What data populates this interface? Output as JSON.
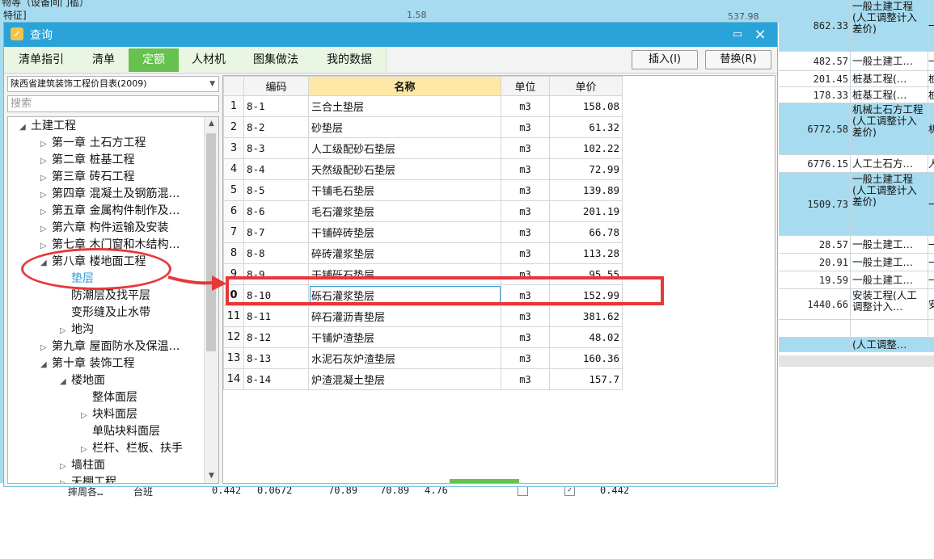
{
  "background": {
    "top_text_1": "物等（设备间门槛）",
    "top_text_2": "特征]",
    "top_num_1": "1.58",
    "top_num_2": "537.98",
    "right_rows": [
      {
        "amount": "862.33",
        "category": "一般土建工程(人工调整计入差价)",
        "extra": "一",
        "h": 64,
        "hl": true
      },
      {
        "amount": "482.57",
        "category": "一般土建工…",
        "extra": "一",
        "h": 24,
        "hl": false
      },
      {
        "amount": "201.45",
        "category": "桩基工程(…",
        "extra": "桩",
        "h": 20,
        "hl": false
      },
      {
        "amount": "178.33",
        "category": "桩基工程(…",
        "extra": "桩",
        "h": 20,
        "hl": false
      },
      {
        "amount": "6772.58",
        "category": "机械土石方工程(人工调整计入差价)",
        "extra": "机",
        "h": 64,
        "hl": true
      },
      {
        "amount": "6776.15",
        "category": "人工土石方…",
        "extra": "人",
        "h": 22,
        "hl": false
      },
      {
        "amount": "1509.73",
        "category": "一般土建工程(人工调整计入差价)",
        "extra": "一",
        "h": 78,
        "hl": true
      },
      {
        "amount": "28.57",
        "category": "一般土建工…",
        "extra": "一",
        "h": 22,
        "hl": false
      },
      {
        "amount": "20.91",
        "category": "一般土建工…",
        "extra": "一",
        "h": 22,
        "hl": false
      },
      {
        "amount": "19.59",
        "category": "一般土建工…",
        "extra": "一",
        "h": 22,
        "hl": false
      },
      {
        "amount": "1440.66",
        "category": "安装工程(人工调整计入…",
        "extra": "安",
        "h": 38,
        "hl": false
      },
      {
        "amount": "",
        "category": "",
        "extra": "",
        "h": 22,
        "hl": false
      },
      {
        "amount": "",
        "category": "(人工调整…",
        "extra": "",
        "h": 18,
        "hl": true
      }
    ],
    "bottom_row": [
      "摔周各…",
      "台班",
      "0.442",
      "0.0672",
      "70.89",
      "70.89",
      "4.76",
      "0.442"
    ]
  },
  "dialog": {
    "title": "查询",
    "close_icon": "×",
    "maximize_icon": "▭",
    "tabs": [
      "清单指引",
      "清单",
      "定额",
      "人材机",
      "图集做法",
      "我的数据"
    ],
    "active_tab": "定额",
    "insert_label": "插入(I)",
    "replace_label": "替换(R)"
  },
  "left_panel": {
    "database": "陕西省建筑装饰工程价目表(2009)",
    "search_placeholder": "搜索",
    "tree": [
      {
        "label": "土建工程",
        "level": 0,
        "state": "expanded"
      },
      {
        "label": "第一章  土石方工程",
        "level": 1,
        "state": "collapsed"
      },
      {
        "label": "第二章  桩基工程",
        "level": 1,
        "state": "collapsed"
      },
      {
        "label": "第三章  砖石工程",
        "level": 1,
        "state": "collapsed"
      },
      {
        "label": "第四章  混凝土及钢筋混…",
        "level": 1,
        "state": "collapsed"
      },
      {
        "label": "第五章  金属构件制作及…",
        "level": 1,
        "state": "collapsed"
      },
      {
        "label": "第六章  构件运输及安装",
        "level": 1,
        "state": "collapsed"
      },
      {
        "label": "第七章  木门窗和木结构…",
        "level": 1,
        "state": "collapsed"
      },
      {
        "label": "第八章  楼地面工程",
        "level": 1,
        "state": "expanded"
      },
      {
        "label": "垫层",
        "level": 2,
        "state": "leaf",
        "selected": true
      },
      {
        "label": "防潮层及找平层",
        "level": 2,
        "state": "leaf"
      },
      {
        "label": "变形缝及止水带",
        "level": 2,
        "state": "leaf"
      },
      {
        "label": "地沟",
        "level": 2,
        "state": "collapsed"
      },
      {
        "label": "第九章  屋面防水及保温…",
        "level": 1,
        "state": "collapsed"
      },
      {
        "label": "第十章  装饰工程",
        "level": 1,
        "state": "expanded"
      },
      {
        "label": "楼地面",
        "level": 2,
        "state": "expanded"
      },
      {
        "label": "整体面层",
        "level": 3,
        "state": "leaf"
      },
      {
        "label": "块料面层",
        "level": 3,
        "state": "collapsed"
      },
      {
        "label": "单贴块料面层",
        "level": 3,
        "state": "leaf"
      },
      {
        "label": "栏杆、栏板、扶手",
        "level": 3,
        "state": "collapsed"
      },
      {
        "label": "墙柱面",
        "level": 2,
        "state": "collapsed"
      },
      {
        "label": "天棚工程",
        "level": 2,
        "state": "collapsed"
      }
    ]
  },
  "grid": {
    "columns": [
      "编码",
      "名称",
      "单位",
      "单价"
    ],
    "rows": [
      {
        "idx": "1",
        "code": "8-1",
        "name": "三合土垫层",
        "unit": "m3",
        "price": "158.08"
      },
      {
        "idx": "2",
        "code": "8-2",
        "name": "砂垫层",
        "unit": "m3",
        "price": "61.32"
      },
      {
        "idx": "3",
        "code": "8-3",
        "name": "人工级配砂石垫层",
        "unit": "m3",
        "price": "102.22"
      },
      {
        "idx": "4",
        "code": "8-4",
        "name": "天然级配砂石垫层",
        "unit": "m3",
        "price": "72.99"
      },
      {
        "idx": "5",
        "code": "8-5",
        "name": "干铺毛石垫层",
        "unit": "m3",
        "price": "139.89"
      },
      {
        "idx": "6",
        "code": "8-6",
        "name": "毛石灌浆垫层",
        "unit": "m3",
        "price": "201.19"
      },
      {
        "idx": "7",
        "code": "8-7",
        "name": "干铺碎砖垫层",
        "unit": "m3",
        "price": "66.78"
      },
      {
        "idx": "8",
        "code": "8-8",
        "name": "碎砖灌浆垫层",
        "unit": "m3",
        "price": "113.28"
      },
      {
        "idx": "9",
        "code": "8-9",
        "name": "干铺砾石垫层",
        "unit": "m3",
        "price": "95.55"
      },
      {
        "idx": "0",
        "code": "8-10",
        "name": "砾石灌浆垫层",
        "unit": "m3",
        "price": "152.99",
        "selected": true
      },
      {
        "idx": "11",
        "code": "8-11",
        "name": "碎石灌沥青垫层",
        "unit": "m3",
        "price": "381.62"
      },
      {
        "idx": "12",
        "code": "8-12",
        "name": "干铺炉渣垫层",
        "unit": "m3",
        "price": "48.02"
      },
      {
        "idx": "13",
        "code": "8-13",
        "name": "水泥石灰炉渣垫层",
        "unit": "m3",
        "price": "160.36"
      },
      {
        "idx": "14",
        "code": "8-14",
        "name": "炉渣混凝土垫层",
        "unit": "m3",
        "price": "157.7"
      }
    ]
  },
  "colors": {
    "accent": "#2aa3d8",
    "tab_active": "#67c14e",
    "annotation": "#e8373a",
    "bg_highlight": "#a7dbef"
  }
}
